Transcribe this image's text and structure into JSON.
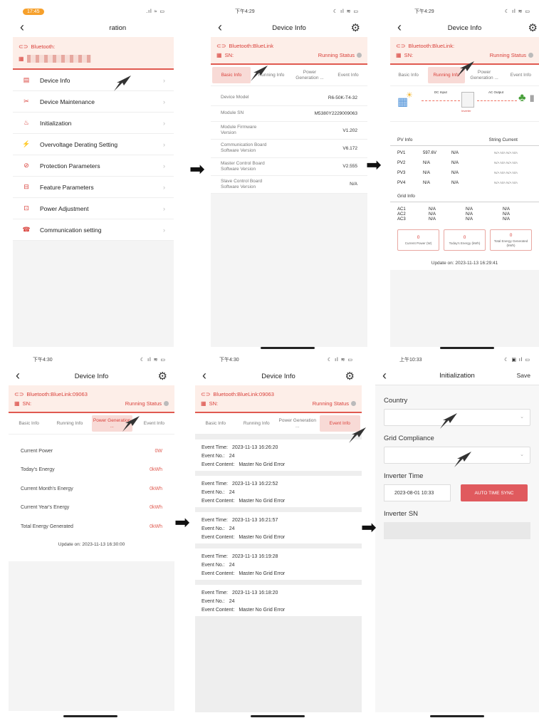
{
  "screen1": {
    "status_time": "17:45",
    "status_icons": ".ıl ≈ ▭",
    "title": "Remote Configuration",
    "bluetooth_label": "Bluetooth:",
    "menu": [
      {
        "icon": "▤",
        "label": "Device Info"
      },
      {
        "icon": "✂",
        "label": "Device Maintenance"
      },
      {
        "icon": "♨",
        "label": "Initialization"
      },
      {
        "icon": "⚡",
        "label": "Overvoltage Derating Setting"
      },
      {
        "icon": "⊘",
        "label": "Protection Parameters"
      },
      {
        "icon": "⊟",
        "label": "Feature Parameters"
      },
      {
        "icon": "⊡",
        "label": "Power Adjustment"
      },
      {
        "icon": "☎",
        "label": "Communication setting"
      }
    ]
  },
  "screen2": {
    "status_time": "下午4:29",
    "status_icons": "☾ ıl ≋ ▭",
    "title": "Device Info",
    "bluetooth": "Bluetooth:BlueLink",
    "sn_label": "SN:",
    "running_status": "Running Status",
    "tabs": [
      "Basic Info",
      "Running Info",
      "Power Generation ...",
      "Event Info"
    ],
    "rows": [
      {
        "k": "Device Model",
        "v": "R6-50K-T4-32"
      },
      {
        "k": "Module SN",
        "v": "M5380Y2229009063"
      },
      {
        "k": "Module Firmware Version",
        "v": "V1.202"
      },
      {
        "k": "Communication Board Software Version",
        "v": "V6.172"
      },
      {
        "k": "Master Control Board Software Version",
        "v": "V2.555"
      },
      {
        "k": "Slave Control Board Software Version",
        "v": "N/A"
      }
    ]
  },
  "screen3": {
    "status_time": "下午4:29",
    "status_icons": "☾ ıl ≋ ▭",
    "title": "Device Info",
    "bluetooth": "Bluetooth:BlueLink:",
    "sn_label": "SN:",
    "running_status": "Running Status",
    "tabs": [
      "Basic Info",
      "Running Info",
      "Power Generation ...",
      "Event Info"
    ],
    "dc_input": "DC Input",
    "ac_output": "AC Output",
    "inverter": "Inverter",
    "pv_info": "PV Info",
    "string_current": "String Current",
    "pv_rows": [
      {
        "n": "PV1",
        "a": "597.6V",
        "b": "N/A",
        "c": "N/A N/A N/A N/A"
      },
      {
        "n": "PV2",
        "a": "N/A",
        "b": "N/A",
        "c": "N/A N/A N/A N/A"
      },
      {
        "n": "PV3",
        "a": "N/A",
        "b": "N/A",
        "c": "N/A N/A N/A N/A"
      },
      {
        "n": "PV4",
        "a": "N/A",
        "b": "N/A",
        "c": "N/A N/A N/A N/A"
      }
    ],
    "grid_info": "Grid Info",
    "grid_rows": [
      {
        "n": "AC1",
        "a": "N/A",
        "b": "N/A",
        "c": "N/A"
      },
      {
        "n": "AC2",
        "a": "N/A",
        "b": "N/A",
        "c": "N/A"
      },
      {
        "n": "AC3",
        "a": "N/A",
        "b": "N/A",
        "c": "N/A"
      }
    ],
    "boxes": [
      {
        "v": "0",
        "l": "Current Power (W)"
      },
      {
        "v": "0",
        "l": "Today's Energy (kWh)"
      },
      {
        "v": "0",
        "l": "Total Energy Generated (kWh)"
      }
    ],
    "update": "Update on:  2023-11-13 16:29:41"
  },
  "screen4": {
    "status_time": "下午4:30",
    "status_icons": "☾ ıl ≋ ▭",
    "title": "Device Info",
    "bluetooth": "Bluetooth:BlueLink:09063",
    "sn_label": "SN:",
    "running_status": "Running Status",
    "tabs": [
      "Basic Info",
      "Running Info",
      "Power Generation ...",
      "Event Info"
    ],
    "rows": [
      {
        "k": "Current Power",
        "v": "0W"
      },
      {
        "k": "Today's Energy",
        "v": "0kWh"
      },
      {
        "k": "Current Month's Energy",
        "v": "0kWh"
      },
      {
        "k": "Current Year's Energy",
        "v": "0kWh"
      },
      {
        "k": "Total Energy Generated",
        "v": "0kWh"
      }
    ],
    "update": "Update on:  2023-11-13 16:30:00"
  },
  "screen5": {
    "status_time": "下午4:30",
    "status_icons": "☾ ıl ≋ ▭",
    "title": "Device Info",
    "bluetooth": "Bluetooth:BlueLink:09063",
    "sn_label": "SN:",
    "running_status": "Running Status",
    "tabs": [
      "Basic Info",
      "Running Info",
      "Power Generation ...",
      "Event Info"
    ],
    "event_time_label": "Event Time:",
    "event_no_label": "Event No.:",
    "event_content_label": "Event Content:",
    "events": [
      {
        "time": "2023-11-13 16:26:20",
        "no": "24",
        "content": "Master No Grid Error"
      },
      {
        "time": "2023-11-13 16:22:52",
        "no": "24",
        "content": "Master No Grid Error"
      },
      {
        "time": "2023-11-13 16:21:57",
        "no": "24",
        "content": "Master No Grid Error"
      },
      {
        "time": "2023-11-13 16:19:28",
        "no": "24",
        "content": "Master No Grid Error"
      },
      {
        "time": "2023-11-13 16:18:20",
        "no": "24",
        "content": "Master No Grid Error"
      }
    ]
  },
  "screen6": {
    "status_time": "上午10:33",
    "status_icons": "☾ ▣ ıl ▭",
    "title": "Initialization",
    "save": "Save",
    "country_label": "Country",
    "grid_label": "Grid Compliance",
    "time_label": "Inverter Time",
    "time_value": "2023-08-01 10:33",
    "sync_button": "AUTO TIME SYNC",
    "sn_label": "Inverter SN"
  },
  "colors": {
    "accent": "#d9403a",
    "accent_bg": "#fdeee8",
    "button": "#e05a5e"
  }
}
